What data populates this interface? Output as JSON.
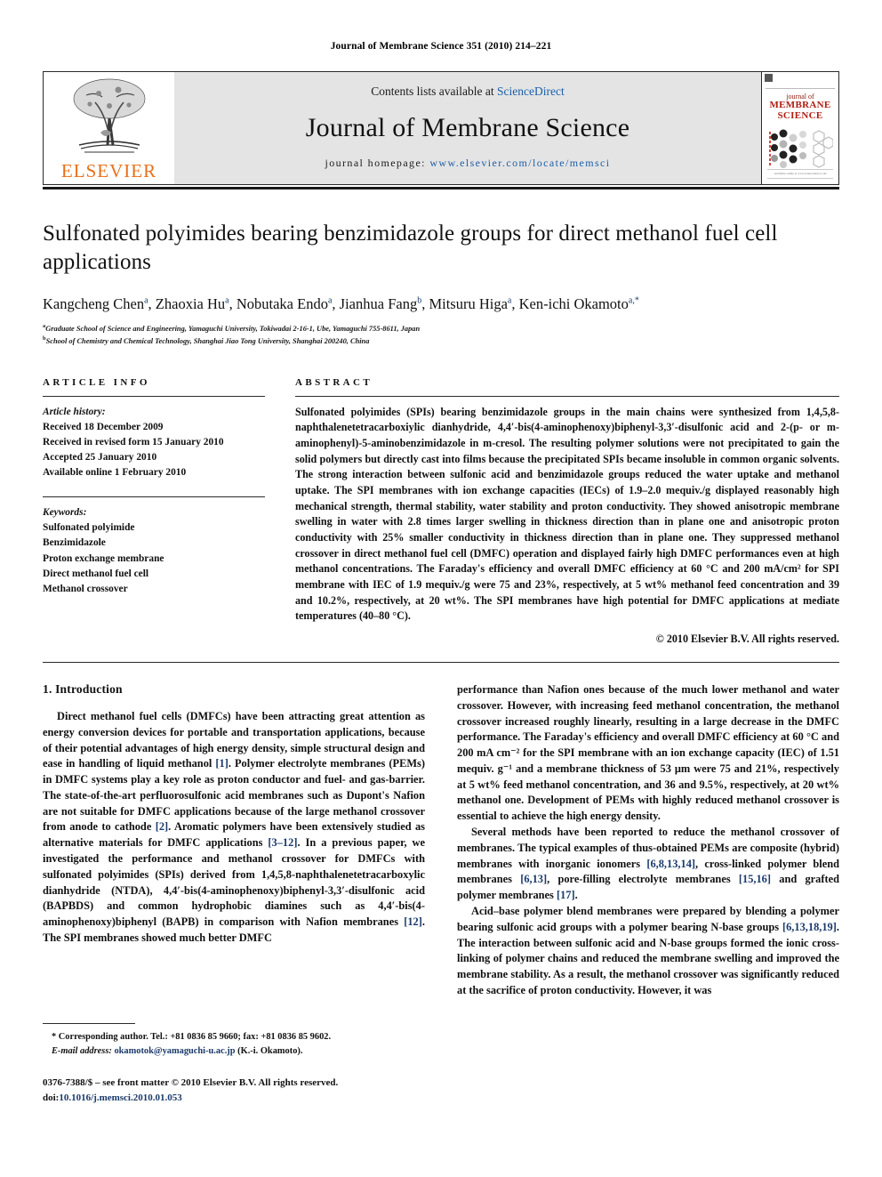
{
  "running_head": "Journal of Membrane Science 351 (2010) 214–221",
  "masthead": {
    "publisher_name": "ELSEVIER",
    "contents_prefix": "Contents lists available at",
    "contents_link": "ScienceDirect",
    "journal_title": "Journal of Membrane Science",
    "homepage_label": "journal homepage:",
    "homepage_url": "www.elsevier.com/locate/memsci",
    "cover": {
      "line1": "journal of",
      "line2": "MEMBRANE",
      "line3": "SCIENCE",
      "footer": "Available online at www.sciencedirect.com"
    }
  },
  "article": {
    "title": "Sulfonated polyimides bearing benzimidazole groups for direct methanol fuel cell applications",
    "authors_html": "Kangcheng Chen<sup>a</sup>, Zhaoxia Hu<sup>a</sup>, Nobutaka Endo<sup>a</sup>, Jianhua Fang<sup>b</sup>, Mitsuru Higa<sup>a</sup>, Ken-ichi Okamoto<sup>a,*</sup>",
    "affiliation_a": "Graduate School of Science and Engineering, Yamaguchi University, Tokiwadai 2-16-1, Ube, Yamaguchi 755-8611, Japan",
    "affiliation_b": "School of Chemistry and Chemical Technology, Shanghai Jiao Tong University, Shanghai 200240, China"
  },
  "info": {
    "heading": "ARTICLE INFO",
    "history_label": "Article history:",
    "history": [
      "Received 18 December 2009",
      "Received in revised form 15 January 2010",
      "Accepted 25 January 2010",
      "Available online 1 February 2010"
    ],
    "keywords_label": "Keywords:",
    "keywords": [
      "Sulfonated polyimide",
      "Benzimidazole",
      "Proton exchange membrane",
      "Direct methanol fuel cell",
      "Methanol crossover"
    ]
  },
  "abstract": {
    "heading": "ABSTRACT",
    "text": "Sulfonated polyimides (SPIs) bearing benzimidazole groups in the main chains were synthesized from 1,4,5,8-naphthalenetetracarboxiylic dianhydride, 4,4′-bis(4-aminophenoxy)biphenyl-3,3′-disulfonic acid and 2-(p- or m-aminophenyl)-5-aminobenzimidazole in m-cresol. The resulting polymer solutions were not precipitated to gain the solid polymers but directly cast into films because the precipitated SPIs became insoluble in common organic solvents. The strong interaction between sulfonic acid and benzimidazole groups reduced the water uptake and methanol uptake. The SPI membranes with ion exchange capacities (IECs) of 1.9–2.0 mequiv./g displayed reasonably high mechanical strength, thermal stability, water stability and proton conductivity. They showed anisotropic membrane swelling in water with 2.8 times larger swelling in thickness direction than in plane one and anisotropic proton conductivity with 25% smaller conductivity in thickness direction than in plane one. They suppressed methanol crossover in direct methanol fuel cell (DMFC) operation and displayed fairly high DMFC performances even at high methanol concentrations. The Faraday's efficiency and overall DMFC efficiency at 60 °C and 200 mA/cm² for SPI membrane with IEC of 1.9 mequiv./g were 75 and 23%, respectively, at 5 wt% methanol feed concentration and 39 and 10.2%, respectively, at 20 wt%. The SPI membranes have high potential for DMFC applications at mediate temperatures (40–80 °C).",
    "copyright": "© 2010 Elsevier B.V. All rights reserved."
  },
  "body": {
    "section_title": "1. Introduction",
    "left_paragraphs": [
      "Direct methanol fuel cells (DMFCs) have been attracting great attention as energy conversion devices for portable and transportation applications, because of their potential advantages of high energy density, simple structural design and ease in handling of liquid methanol [1]. Polymer electrolyte membranes (PEMs) in DMFC systems play a key role as proton conductor and fuel- and gas-barrier. The state-of-the-art perfluorosulfonic acid membranes such as Dupont's Nafion are not suitable for DMFC applications because of the large methanol crossover from anode to cathode [2]. Aromatic polymers have been extensively studied as alternative materials for DMFC applications [3–12]. In a previous paper, we investigated the performance and methanol crossover for DMFCs with sulfonated polyimides (SPIs) derived from 1,4,5,8-naphthalenetetracarboxylic dianhydride (NTDA), 4,4′-bis(4-aminophenoxy)biphenyl-3,3′-disulfonic acid (BAPBDS) and common hydrophobic diamines such as 4,4′-bis(4-aminophenoxy)biphenyl (BAPB) in comparison with Nafion membranes [12]. The SPI membranes showed much better DMFC"
    ],
    "right_paragraphs": [
      "performance than Nafion ones because of the much lower methanol and water crossover. However, with increasing feed methanol concentration, the methanol crossover increased roughly linearly, resulting in a large decrease in the DMFC performance. The Faraday's efficiency and overall DMFC efficiency at 60 °C and 200 mA cm⁻² for the SPI membrane with an ion exchange capacity (IEC) of 1.51 mequiv. g⁻¹ and a membrane thickness of 53 μm were 75 and 21%, respectively at 5 wt% feed methanol concentration, and 36 and 9.5%, respectively, at 20 wt% methanol one. Development of PEMs with highly reduced methanol crossover is essential to achieve the high energy density.",
      "Several methods have been reported to reduce the methanol crossover of membranes. The typical examples of thus-obtained PEMs are composite (hybrid) membranes with inorganic ionomers [6,8,13,14], cross-linked polymer blend membranes [6,13], pore-filling electrolyte membranes [15,16] and grafted polymer membranes [17].",
      "Acid–base polymer blend membranes were prepared by blending a polymer bearing sulfonic acid groups with a polymer bearing N-base groups [6,13,18,19]. The interaction between sulfonic acid and N-base groups formed the ionic cross-linking of polymer chains and reduced the membrane swelling and improved the membrane stability. As a result, the methanol crossover was significantly reduced at the sacrifice of proton conductivity. However, it was"
    ]
  },
  "footnote": {
    "corresponding": "* Corresponding author. Tel.: +81 0836 85 9660; fax: +81 0836 85 9602.",
    "email_label": "E-mail address:",
    "email": "okamotok@yamaguchi-u.ac.jp",
    "email_suffix": "(K.-i. Okamoto).",
    "issn_line": "0376-7388/$ – see front matter © 2010 Elsevier B.V. All rights reserved.",
    "doi_label": "doi:",
    "doi_value": "10.1016/j.memsci.2010.01.053"
  },
  "colors": {
    "link_blue": "#1B5FAA",
    "ref_blue": "#1B3A6B",
    "elsevier_orange": "#E8701A",
    "cover_red": "#b01d12",
    "masthead_gray": "#e4e4e4"
  }
}
